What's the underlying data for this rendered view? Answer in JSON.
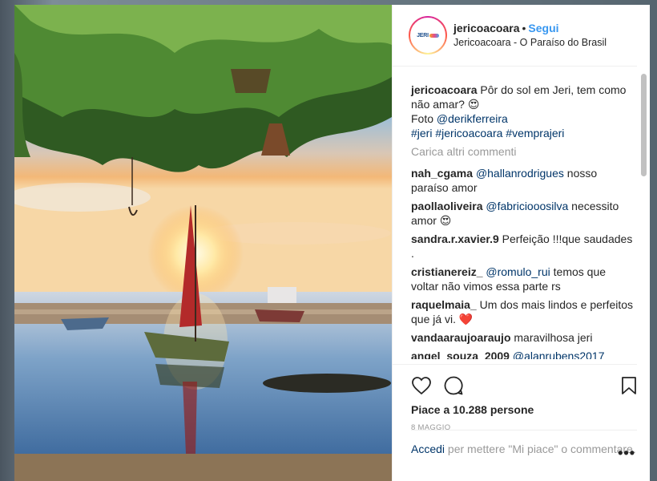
{
  "post": {
    "username": "jericoacoara",
    "separator": "•",
    "follow_label": "Segui",
    "location": "Jericoacoara - O Paraíso do Brasil",
    "avatar_text": "JERI"
  },
  "caption": {
    "username": "jericoacoara",
    "text": "Pôr do sol em Jeri, tem como não amar? 😍",
    "photo_prefix": "Foto ",
    "photo_mention": "@derikferreira",
    "hashtags": "#jeri #jericoacoara #vemprajeri"
  },
  "load_more_label": "Carica altri commenti",
  "comments": [
    {
      "user": "nah_cgama",
      "mention": "@hallanrodrigues",
      "text": " nosso paraíso amor"
    },
    {
      "user": "paollaoliveira",
      "mention": "@fabriciooosilva",
      "text": " necessito amor 😍"
    },
    {
      "user": "sandra.r.xavier.9",
      "mention": "",
      "text": "Perfeição !!!que saudades ."
    },
    {
      "user": "cristianereiz_",
      "mention": "@romulo_rui",
      "text": " temos que voltar não vimos essa parte rs"
    },
    {
      "user": "raquelmaia_",
      "mention": "",
      "text": "Um dos mais lindos e perfeitos que já vi. ❤️"
    },
    {
      "user": "vandaaraujoaraujo",
      "mention": "",
      "text": "maravilhosa jeri"
    },
    {
      "user": "angel_souza_2009",
      "mention": "@alanrubens2017",
      "text": ""
    }
  ],
  "likes_label": "Piace a 10.288 persone",
  "date_label": "8 MAGGIO",
  "login": {
    "link_label": "Accedi",
    "text": " per mettere \"Mi piace\" o commentare."
  },
  "more_label": "•••",
  "icons": {
    "like": "heart-icon",
    "comment": "comment-icon",
    "save": "bookmark-icon",
    "more": "more-options-icon"
  },
  "colors": {
    "follow": "#3897f0",
    "link": "#003569",
    "muted": "#999999",
    "heart": "#ed4956"
  }
}
